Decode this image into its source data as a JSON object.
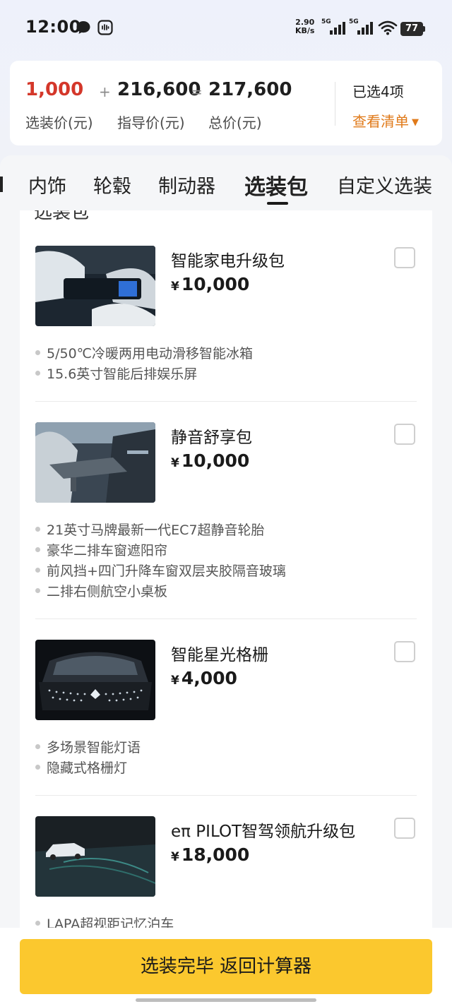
{
  "status_bar": {
    "time": "12:00",
    "net_speed_value": "2.90",
    "net_speed_unit": "KB/s",
    "sim1_tag": "5G",
    "sim2_tag": "5G",
    "battery": "77"
  },
  "price_summary": {
    "option_price": "1,000",
    "option_label": "选装价(元)",
    "plus": "+",
    "guide_price": "216,600",
    "guide_label": "指导价(元)",
    "equals": "=",
    "total_price": "217,600",
    "total_label": "总价(元)",
    "selected_count": "已选4项",
    "view_list": "查看清单",
    "option_color": "#d4372a",
    "link_color": "#e07a1a"
  },
  "tabs": [
    {
      "label": "内饰"
    },
    {
      "label": "轮毂"
    },
    {
      "label": "制动器"
    },
    {
      "label": "选装包",
      "active": true
    },
    {
      "label": "自定义选装"
    }
  ],
  "section_title_cut": "选装包",
  "packages": [
    {
      "name": "智能家电升级包",
      "currency": "¥",
      "price": "10,000",
      "checked": false,
      "thumb_icon": "interior-fridge-image",
      "features": [
        "5/50℃冷暖两用电动滑移智能冰箱",
        "15.6英寸智能后排娱乐屏"
      ]
    },
    {
      "name": "静音舒享包",
      "currency": "¥",
      "price": "10,000",
      "checked": false,
      "thumb_icon": "seat-table-image",
      "features": [
        "21英寸马牌最新一代EC7超静音轮胎",
        "豪华二排车窗遮阳帘",
        "前风挡+四门升降车窗双层夹胶隔音玻璃",
        "二排右侧航空小桌板"
      ]
    },
    {
      "name": "智能星光格栅",
      "currency": "¥",
      "price": "4,000",
      "checked": false,
      "thumb_icon": "grille-image",
      "features": [
        "多场景智能灯语",
        "隐藏式格栅灯"
      ]
    },
    {
      "name": "eπ PILOT智驾领航升级包",
      "currency": "¥",
      "price": "18,000",
      "checked": false,
      "thumb_icon": "parking-image",
      "features": [
        "LAPA超视距记忆泊车"
      ]
    }
  ],
  "cta_label": "选装完毕 返回计算器",
  "cta_color": "#fbc82e"
}
